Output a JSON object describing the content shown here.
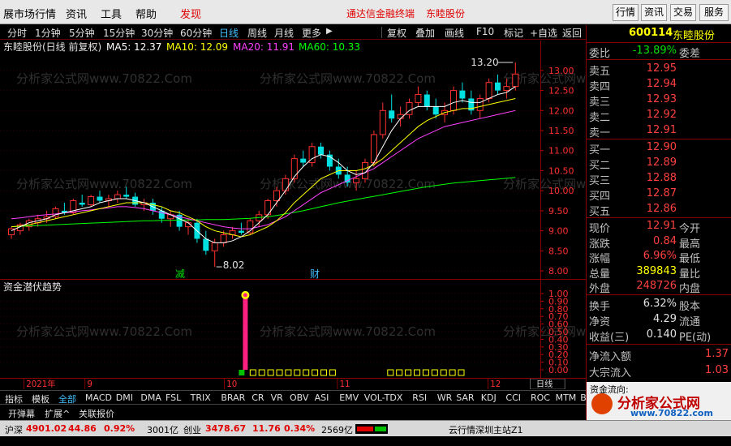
{
  "menubar": {
    "items": [
      "展市场行情",
      "资讯",
      "工具",
      "帮助",
      "发现"
    ],
    "link1": "通达信金融终端",
    "link2": "东睦股份",
    "buttons": [
      "行情",
      "资讯",
      "交易",
      "服务"
    ]
  },
  "toolbar": {
    "periods": [
      "分时",
      "1分钟",
      "5分钟",
      "15分钟",
      "30分钟",
      "60分钟",
      "日线",
      "周线",
      "月线",
      "更多"
    ],
    "active": "日线",
    "tools": [
      "复权",
      "叠加",
      "画线",
      "F10",
      "标记",
      "+自选",
      "返回"
    ]
  },
  "chart": {
    "title": "东睦股份(日线 前复权)",
    "ma5": "MA5: 12.37",
    "ma10": "MA10: 12.09",
    "ma20": "MA20: 11.91",
    "ma60": "MA60: 10.33",
    "high_label": "13.20",
    "low_label": "8.02",
    "jian_label": "减",
    "cai_label": "财",
    "watermark": "分析家公式网www.70822.Com",
    "y_ticks": [
      "13.00",
      "12.50",
      "12.00",
      "11.50",
      "11.00",
      "10.50",
      "10.00",
      "9.50",
      "9.00",
      "8.50",
      "8.00"
    ],
    "indicator_title": "资金潜伏趋势",
    "ind_ticks": [
      "1.00",
      "0.90",
      "0.80",
      "0.70",
      "0.60",
      "0.50",
      "0.40",
      "0.30",
      "0.20",
      "0.10",
      "0.00"
    ]
  },
  "chart_data": {
    "type": "candlestick",
    "x_labels": [
      "2021年",
      "9",
      "10",
      "11",
      "12"
    ],
    "ylim": [
      8.0,
      13.2
    ],
    "candles": [
      [
        8.9,
        9.1,
        8.8,
        9.05
      ],
      [
        9.0,
        9.2,
        8.9,
        9.15
      ],
      [
        9.1,
        9.3,
        9.0,
        9.25
      ],
      [
        9.2,
        9.4,
        9.1,
        9.3
      ],
      [
        9.3,
        9.5,
        9.2,
        9.35
      ],
      [
        9.35,
        9.6,
        9.3,
        9.55
      ],
      [
        9.5,
        9.7,
        9.4,
        9.45
      ],
      [
        9.45,
        9.8,
        9.4,
        9.75
      ],
      [
        9.7,
        9.9,
        9.6,
        9.65
      ],
      [
        9.65,
        9.9,
        9.6,
        9.85
      ],
      [
        9.85,
        10.0,
        9.7,
        9.75
      ],
      [
        9.75,
        9.9,
        9.6,
        9.8
      ],
      [
        9.8,
        10.0,
        9.7,
        9.9
      ],
      [
        9.9,
        10.1,
        9.8,
        9.85
      ],
      [
        9.85,
        9.95,
        9.6,
        9.65
      ],
      [
        9.65,
        9.8,
        9.5,
        9.7
      ],
      [
        9.7,
        9.8,
        9.4,
        9.5
      ],
      [
        9.5,
        9.6,
        9.2,
        9.3
      ],
      [
        9.3,
        9.5,
        9.1,
        9.4
      ],
      [
        9.4,
        9.5,
        9.0,
        9.1
      ],
      [
        9.1,
        9.3,
        8.9,
        9.2
      ],
      [
        9.2,
        9.3,
        8.7,
        8.8
      ],
      [
        8.8,
        9.0,
        8.4,
        8.5
      ],
      [
        8.5,
        8.8,
        8.1,
        8.7
      ],
      [
        8.7,
        9.0,
        8.6,
        8.9
      ],
      [
        8.9,
        9.1,
        8.8,
        9.0
      ],
      [
        9.0,
        9.2,
        8.9,
        8.95
      ],
      [
        8.95,
        9.3,
        8.9,
        9.25
      ],
      [
        9.25,
        9.5,
        9.1,
        9.4
      ],
      [
        9.4,
        9.8,
        9.3,
        9.75
      ],
      [
        9.75,
        10.1,
        9.6,
        10.0
      ],
      [
        10.0,
        10.4,
        9.9,
        10.3
      ],
      [
        10.3,
        10.9,
        10.2,
        10.8
      ],
      [
        10.8,
        11.0,
        10.6,
        10.7
      ],
      [
        10.7,
        11.2,
        10.6,
        11.1
      ],
      [
        11.1,
        11.2,
        10.8,
        10.9
      ],
      [
        10.9,
        11.0,
        10.5,
        10.6
      ],
      [
        10.6,
        10.8,
        10.3,
        10.4
      ],
      [
        10.4,
        10.6,
        10.1,
        10.2
      ],
      [
        10.2,
        10.5,
        10.0,
        10.3
      ],
      [
        10.3,
        10.8,
        10.2,
        10.7
      ],
      [
        10.7,
        11.5,
        10.6,
        11.4
      ],
      [
        11.4,
        12.2,
        11.3,
        12.0
      ],
      [
        12.0,
        12.4,
        11.7,
        11.8
      ],
      [
        11.8,
        12.1,
        11.6,
        11.9
      ],
      [
        11.9,
        12.3,
        11.8,
        12.2
      ],
      [
        12.2,
        12.6,
        12.1,
        12.4
      ],
      [
        12.4,
        12.5,
        12.0,
        12.1
      ],
      [
        12.1,
        12.3,
        11.8,
        11.9
      ],
      [
        11.9,
        12.2,
        11.7,
        12.0
      ],
      [
        12.0,
        12.6,
        11.9,
        12.5
      ],
      [
        12.5,
        12.7,
        12.2,
        12.3
      ],
      [
        12.3,
        12.5,
        11.9,
        12.0
      ],
      [
        12.0,
        12.4,
        11.8,
        12.3
      ],
      [
        12.3,
        12.8,
        12.2,
        12.7
      ],
      [
        12.7,
        12.9,
        12.4,
        12.5
      ],
      [
        12.5,
        12.8,
        12.3,
        12.6
      ],
      [
        12.6,
        13.2,
        12.5,
        12.91
      ]
    ],
    "ma5": [
      9.0,
      9.1,
      9.2,
      9.25,
      9.3,
      9.4,
      9.45,
      9.5,
      9.55,
      9.6,
      9.7,
      9.75,
      9.8,
      9.8,
      9.75,
      9.7,
      9.6,
      9.5,
      9.4,
      9.3,
      9.2,
      9.0,
      8.8,
      8.7,
      8.7,
      8.75,
      8.85,
      9.0,
      9.2,
      9.4,
      9.7,
      10.0,
      10.35,
      10.6,
      10.8,
      10.9,
      10.85,
      10.7,
      10.5,
      10.4,
      10.45,
      10.7,
      11.1,
      11.5,
      11.8,
      12.0,
      12.1,
      12.1,
      12.1,
      12.1,
      12.2,
      12.25,
      12.2,
      12.2,
      12.3,
      12.4,
      12.45,
      12.6
    ],
    "ma10": [
      9.1,
      9.12,
      9.15,
      9.2,
      9.25,
      9.3,
      9.35,
      9.4,
      9.45,
      9.5,
      9.55,
      9.6,
      9.65,
      9.7,
      9.7,
      9.7,
      9.65,
      9.6,
      9.5,
      9.45,
      9.35,
      9.25,
      9.1,
      9.0,
      8.95,
      8.9,
      8.85,
      8.9,
      9.0,
      9.1,
      9.25,
      9.45,
      9.7,
      9.9,
      10.1,
      10.3,
      10.4,
      10.5,
      10.5,
      10.5,
      10.55,
      10.65,
      10.8,
      11.0,
      11.2,
      11.4,
      11.6,
      11.75,
      11.85,
      11.95,
      12.0,
      12.05,
      12.05,
      12.1,
      12.15,
      12.2,
      12.25,
      12.3
    ],
    "ma20": [
      9.3,
      9.32,
      9.35,
      9.38,
      9.4,
      9.42,
      9.45,
      9.47,
      9.5,
      9.52,
      9.55,
      9.57,
      9.6,
      9.6,
      9.58,
      9.55,
      9.5,
      9.45,
      9.4,
      9.35,
      9.3,
      9.25,
      9.2,
      9.15,
      9.1,
      9.07,
      9.05,
      9.05,
      9.1,
      9.15,
      9.25,
      9.35,
      9.5,
      9.65,
      9.8,
      9.95,
      10.05,
      10.15,
      10.25,
      10.35,
      10.45,
      10.55,
      10.7,
      10.85,
      11.0,
      11.15,
      11.3,
      11.4,
      11.5,
      11.6,
      11.65,
      11.7,
      11.75,
      11.8,
      11.85,
      11.9,
      11.95,
      12.0
    ],
    "ma60": [
      9.1,
      9.11,
      9.12,
      9.13,
      9.14,
      9.15,
      9.16,
      9.17,
      9.18,
      9.19,
      9.2,
      9.21,
      9.22,
      9.23,
      9.24,
      9.25,
      9.25,
      9.26,
      9.26,
      9.27,
      9.27,
      9.27,
      9.28,
      9.28,
      9.28,
      9.29,
      9.3,
      9.31,
      9.33,
      9.35,
      9.38,
      9.42,
      9.46,
      9.5,
      9.55,
      9.6,
      9.65,
      9.7,
      9.74,
      9.78,
      9.82,
      9.86,
      9.9,
      9.94,
      9.98,
      10.02,
      10.06,
      10.1,
      10.13,
      10.16,
      10.19,
      10.21,
      10.23,
      10.25,
      10.27,
      10.29,
      10.31,
      10.33
    ],
    "indicator_bar_index": 26
  },
  "tabs": [
    "指标",
    "模板",
    "全部",
    "MACD",
    "DMI",
    "DMA",
    "FSL",
    "TRIX",
    "BRAR",
    "CR",
    "VR",
    "OBV",
    "ASI",
    "EMV",
    "VOL-TDX",
    "RSI",
    "WR",
    "SAR",
    "KDJ",
    "CCI",
    "ROC",
    "MTM",
    "BOLL"
  ],
  "tabs_row2": [
    "开弹幕",
    "扩展^",
    "关联报价"
  ],
  "period_mode": "日线",
  "quote": {
    "code": "600114",
    "name": "东睦股份",
    "weibi_label": "委比",
    "weibi": "-13.89%",
    "weicha_label": "委差",
    "asks": [
      [
        "卖五",
        "12.95"
      ],
      [
        "卖四",
        "12.94"
      ],
      [
        "卖三",
        "12.93"
      ],
      [
        "卖二",
        "12.92"
      ],
      [
        "卖一",
        "12.91"
      ]
    ],
    "bids": [
      [
        "买一",
        "12.90"
      ],
      [
        "买二",
        "12.89"
      ],
      [
        "买三",
        "12.88"
      ],
      [
        "买四",
        "12.87"
      ],
      [
        "买五",
        "12.86"
      ]
    ],
    "stats": [
      [
        "现价",
        "12.91",
        "今开"
      ],
      [
        "涨跌",
        "0.84",
        "最高"
      ],
      [
        "涨幅",
        "6.96%",
        "最低"
      ],
      [
        "总量",
        "389843",
        "量比"
      ],
      [
        "外盘",
        "248726",
        "内盘"
      ]
    ],
    "stats2": [
      [
        "换手",
        "6.32%",
        "股本"
      ],
      [
        "净资",
        "4.29",
        "流通"
      ],
      [
        "收益(三)",
        "0.140",
        "PE(动)"
      ]
    ],
    "flow": [
      [
        "净流入额",
        "1.37"
      ],
      [
        "大宗流入",
        "1.03"
      ]
    ],
    "panel_title": "资金流向:"
  },
  "status": {
    "sh_label": "沪深",
    "sh_val": "4901.02",
    "sh_chg": "44.86",
    "sh_pct": "0.92%",
    "sh_amt": "3001亿",
    "cy_label": "创业",
    "cy_val": "3478.67",
    "cy_chg": "11.76",
    "cy_pct": "0.34%",
    "cy_amt": "2569亿",
    "server": "云行情深圳主站Z1"
  },
  "logo_text": "分析家公式网",
  "logo_url": "www.70822.com",
  "colors": {
    "up": "#ff3030",
    "down": "#00e0e0",
    "ma5": "#ffffff",
    "ma10": "#ffff00",
    "ma20": "#ff40ff",
    "ma60": "#00ff00"
  }
}
